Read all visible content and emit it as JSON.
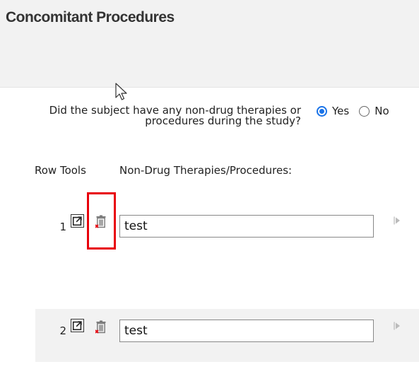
{
  "header": {
    "title": "Concomitant Procedures"
  },
  "question": {
    "text": "Did the subject have any non-drug therapies or procedures during the study?",
    "options": [
      {
        "label": "Yes",
        "selected": true
      },
      {
        "label": "No",
        "selected": false
      }
    ]
  },
  "table": {
    "columns": [
      "Row Tools",
      "Non-Drug Therapies/Procedures:"
    ],
    "rows": [
      {
        "number": "1",
        "value": "test"
      },
      {
        "number": "2",
        "value": "test"
      }
    ]
  },
  "icons": {
    "open": "external-link-icon",
    "delete": "trash-icon",
    "arrow": "play-arrow-icon"
  },
  "colors": {
    "accent": "#1a73e8",
    "highlight": "#e8000b",
    "delete_marker": "#e8000b"
  }
}
